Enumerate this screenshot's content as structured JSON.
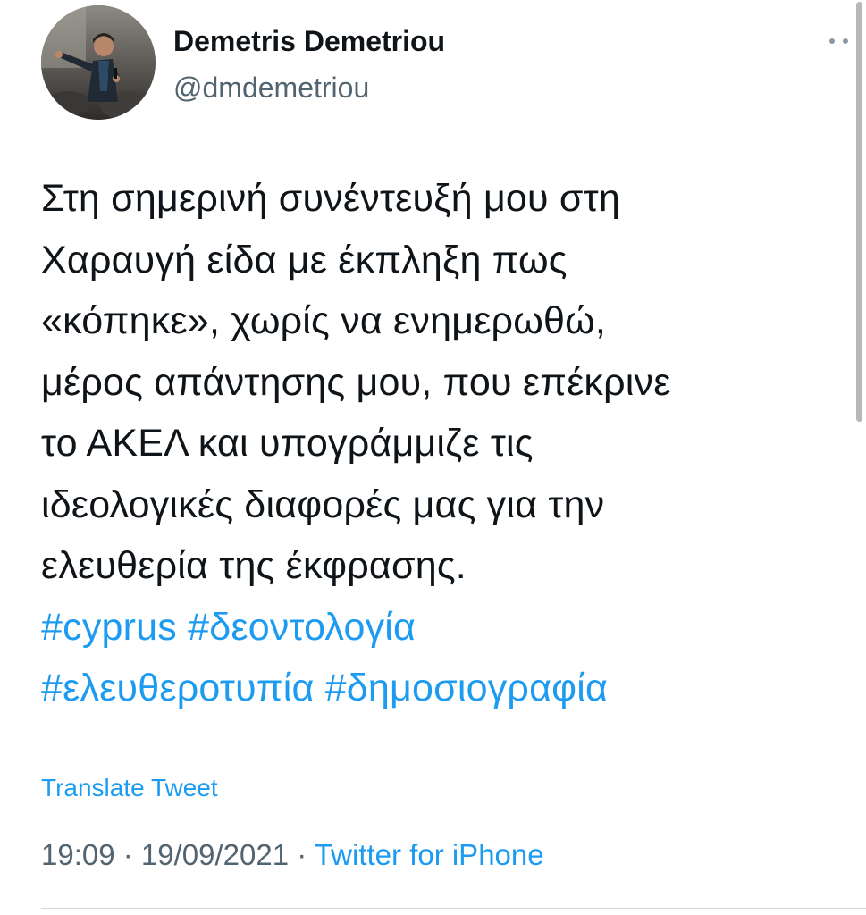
{
  "author": {
    "display_name": "Demetris Demetriou",
    "handle": "@dmdemetriou",
    "avatar_icon": "profile-photo"
  },
  "more_icon": "more-horizontal-icon",
  "tweet": {
    "lines": [
      "Στη σημερινή συνέντευξή μου στη",
      "Χαραυγή είδα με έκπληξη πως",
      "«κόπηκε», χωρίς να ενημερωθώ,",
      "μέρος απάντησης μου, που επέκρινε",
      "το ΑΚΕΛ και υπογράμμιζε τις",
      "ιδεολογικές διαφορές μας για την",
      "ελευθερία της έκφρασης."
    ],
    "hashtags": [
      "#cyprus",
      "#δεοντολογία",
      "#ελευθεροτυπία",
      "#δημοσιογραφία"
    ]
  },
  "translate_label": "Translate Tweet",
  "meta": {
    "time": "19:09",
    "separator": " · ",
    "date": "19/09/2021",
    "source": "Twitter for iPhone"
  },
  "colors": {
    "link": "#1d9bf0",
    "text": "#0f1419",
    "secondary": "#536471"
  }
}
